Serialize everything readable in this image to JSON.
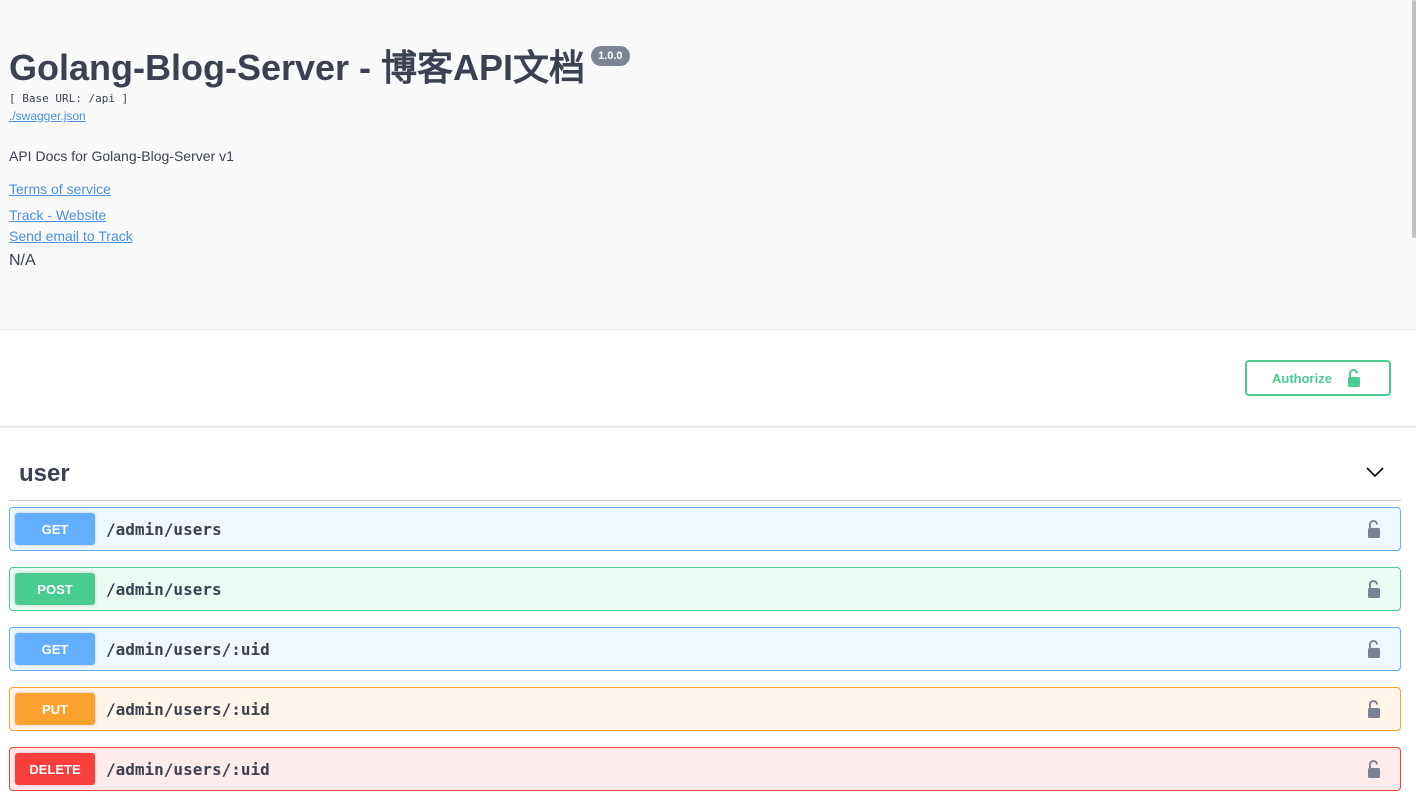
{
  "info": {
    "title": "Golang-Blog-Server - 博客API文档",
    "version": "1.0.0",
    "base_url": "[ Base URL: /api ]",
    "spec_link": "./swagger.json",
    "description": "API Docs for Golang-Blog-Server v1",
    "terms_link": "Terms of service",
    "website_link": "Track - Website",
    "email_link": "Send email to Track",
    "license": "N/A"
  },
  "scheme": {
    "authorize_label": "Authorize",
    "authorize_icon": "unlock-icon"
  },
  "tag": {
    "name": "user",
    "toggle_icon": "chevron-down-icon"
  },
  "colors": {
    "get": "#61affe",
    "post": "#49cc90",
    "put": "#fca130",
    "delete": "#f93e3e",
    "link": "#4990e2",
    "text": "#3b4151"
  },
  "operations": [
    {
      "method": "GET",
      "path": "/admin/users"
    },
    {
      "method": "POST",
      "path": "/admin/users"
    },
    {
      "method": "GET",
      "path": "/admin/users/:uid"
    },
    {
      "method": "PUT",
      "path": "/admin/users/:uid"
    },
    {
      "method": "DELETE",
      "path": "/admin/users/:uid"
    }
  ]
}
